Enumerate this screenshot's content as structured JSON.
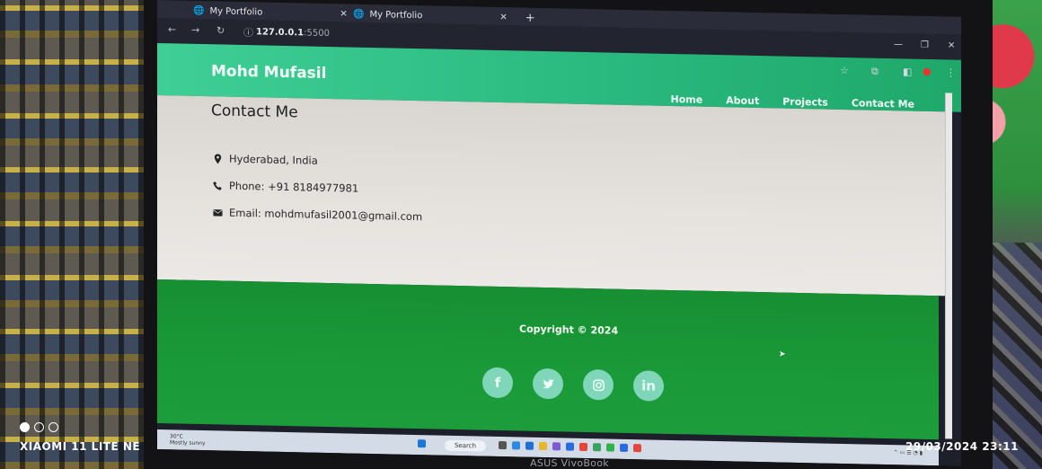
{
  "browser": {
    "tab1_title": "My Portfolio",
    "tab2_title": "My Portfolio",
    "new_tab": "+",
    "url_host": "127.0.0.1",
    "url_port": ":5500"
  },
  "site": {
    "logo": "Mohd Mufasil",
    "nav": [
      "Home",
      "About",
      "Projects",
      "Contact Me"
    ],
    "heading": "Contact Me",
    "location": "Hyderabad, India",
    "phone": "Phone: +91 8184977981",
    "email": "Email: mohdmufasil2001@gmail.com",
    "copyright": "Copyright © 2024",
    "socials": [
      "facebook-icon",
      "twitter-icon",
      "instagram-icon",
      "linkedin-icon"
    ],
    "header_color": "#2ab97f",
    "footer_color": "#1a9a38"
  },
  "taskbar": {
    "search": "Search",
    "weather_temp": "30°C",
    "weather_desc": "Mostly sunny"
  },
  "laptop_brand": "ASUS VivoBook",
  "watermark": {
    "device": "XIAOMI 11 LITE NE",
    "datetime": "29/03/2024  23:11"
  }
}
